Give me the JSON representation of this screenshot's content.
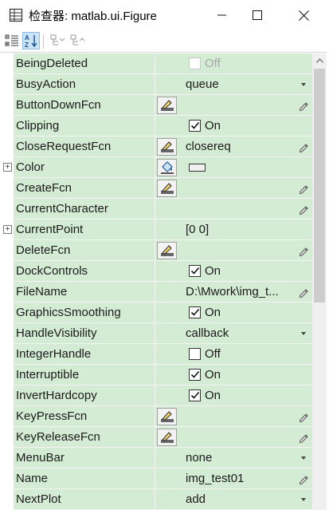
{
  "window": {
    "title": "检查器: matlab.ui.Figure",
    "app_icon": "inspector-grid-icon",
    "minimize_icon": "minimize-icon",
    "maximize_icon": "maximize-icon",
    "close_icon": "close-icon"
  },
  "toolbar": {
    "buttons": [
      {
        "icon": "categorized-view-icon",
        "active": false
      },
      {
        "icon": "sort-az-icon",
        "active": true
      },
      {
        "icon": "expand-all-icon",
        "active": false
      },
      {
        "icon": "collapse-all-icon",
        "active": false
      }
    ]
  },
  "colors": {
    "row_bg": "#d4ecd4",
    "grid_line": "#f4f4f4",
    "sort_active_bg": "#cce4f7"
  },
  "properties": [
    {
      "name": "BeingDeleted",
      "kind": "checkbox",
      "checked": false,
      "label": "Off",
      "disabled": true
    },
    {
      "name": "BusyAction",
      "kind": "dropdown",
      "value": "queue"
    },
    {
      "name": "ButtonDownFcn",
      "kind": "callback",
      "value": ""
    },
    {
      "name": "Clipping",
      "kind": "checkbox",
      "checked": true,
      "label": "On"
    },
    {
      "name": "CloseRequestFcn",
      "kind": "callback",
      "value": "closereq"
    },
    {
      "name": "Color",
      "kind": "color",
      "expandable": true,
      "swatch": "#f0f0f0"
    },
    {
      "name": "CreateFcn",
      "kind": "callback",
      "value": ""
    },
    {
      "name": "CurrentCharacter",
      "kind": "text",
      "value": ""
    },
    {
      "name": "CurrentPoint",
      "kind": "readonly",
      "value": "[0 0]",
      "expandable": true
    },
    {
      "name": "DeleteFcn",
      "kind": "callback",
      "value": ""
    },
    {
      "name": "DockControls",
      "kind": "checkbox",
      "checked": true,
      "label": "On"
    },
    {
      "name": "FileName",
      "kind": "text",
      "value": "D:\\Mwork\\img_t..."
    },
    {
      "name": "GraphicsSmoothing",
      "kind": "checkbox",
      "checked": true,
      "label": "On"
    },
    {
      "name": "HandleVisibility",
      "kind": "dropdown",
      "value": "callback"
    },
    {
      "name": "IntegerHandle",
      "kind": "checkbox",
      "checked": false,
      "label": "Off"
    },
    {
      "name": "Interruptible",
      "kind": "checkbox",
      "checked": true,
      "label": "On"
    },
    {
      "name": "InvertHardcopy",
      "kind": "checkbox",
      "checked": true,
      "label": "On"
    },
    {
      "name": "KeyPressFcn",
      "kind": "callback",
      "value": ""
    },
    {
      "name": "KeyReleaseFcn",
      "kind": "callback",
      "value": ""
    },
    {
      "name": "MenuBar",
      "kind": "dropdown",
      "value": "none"
    },
    {
      "name": "Name",
      "kind": "text",
      "value": "img_test01"
    },
    {
      "name": "NextPlot",
      "kind": "dropdown",
      "value": "add"
    }
  ]
}
